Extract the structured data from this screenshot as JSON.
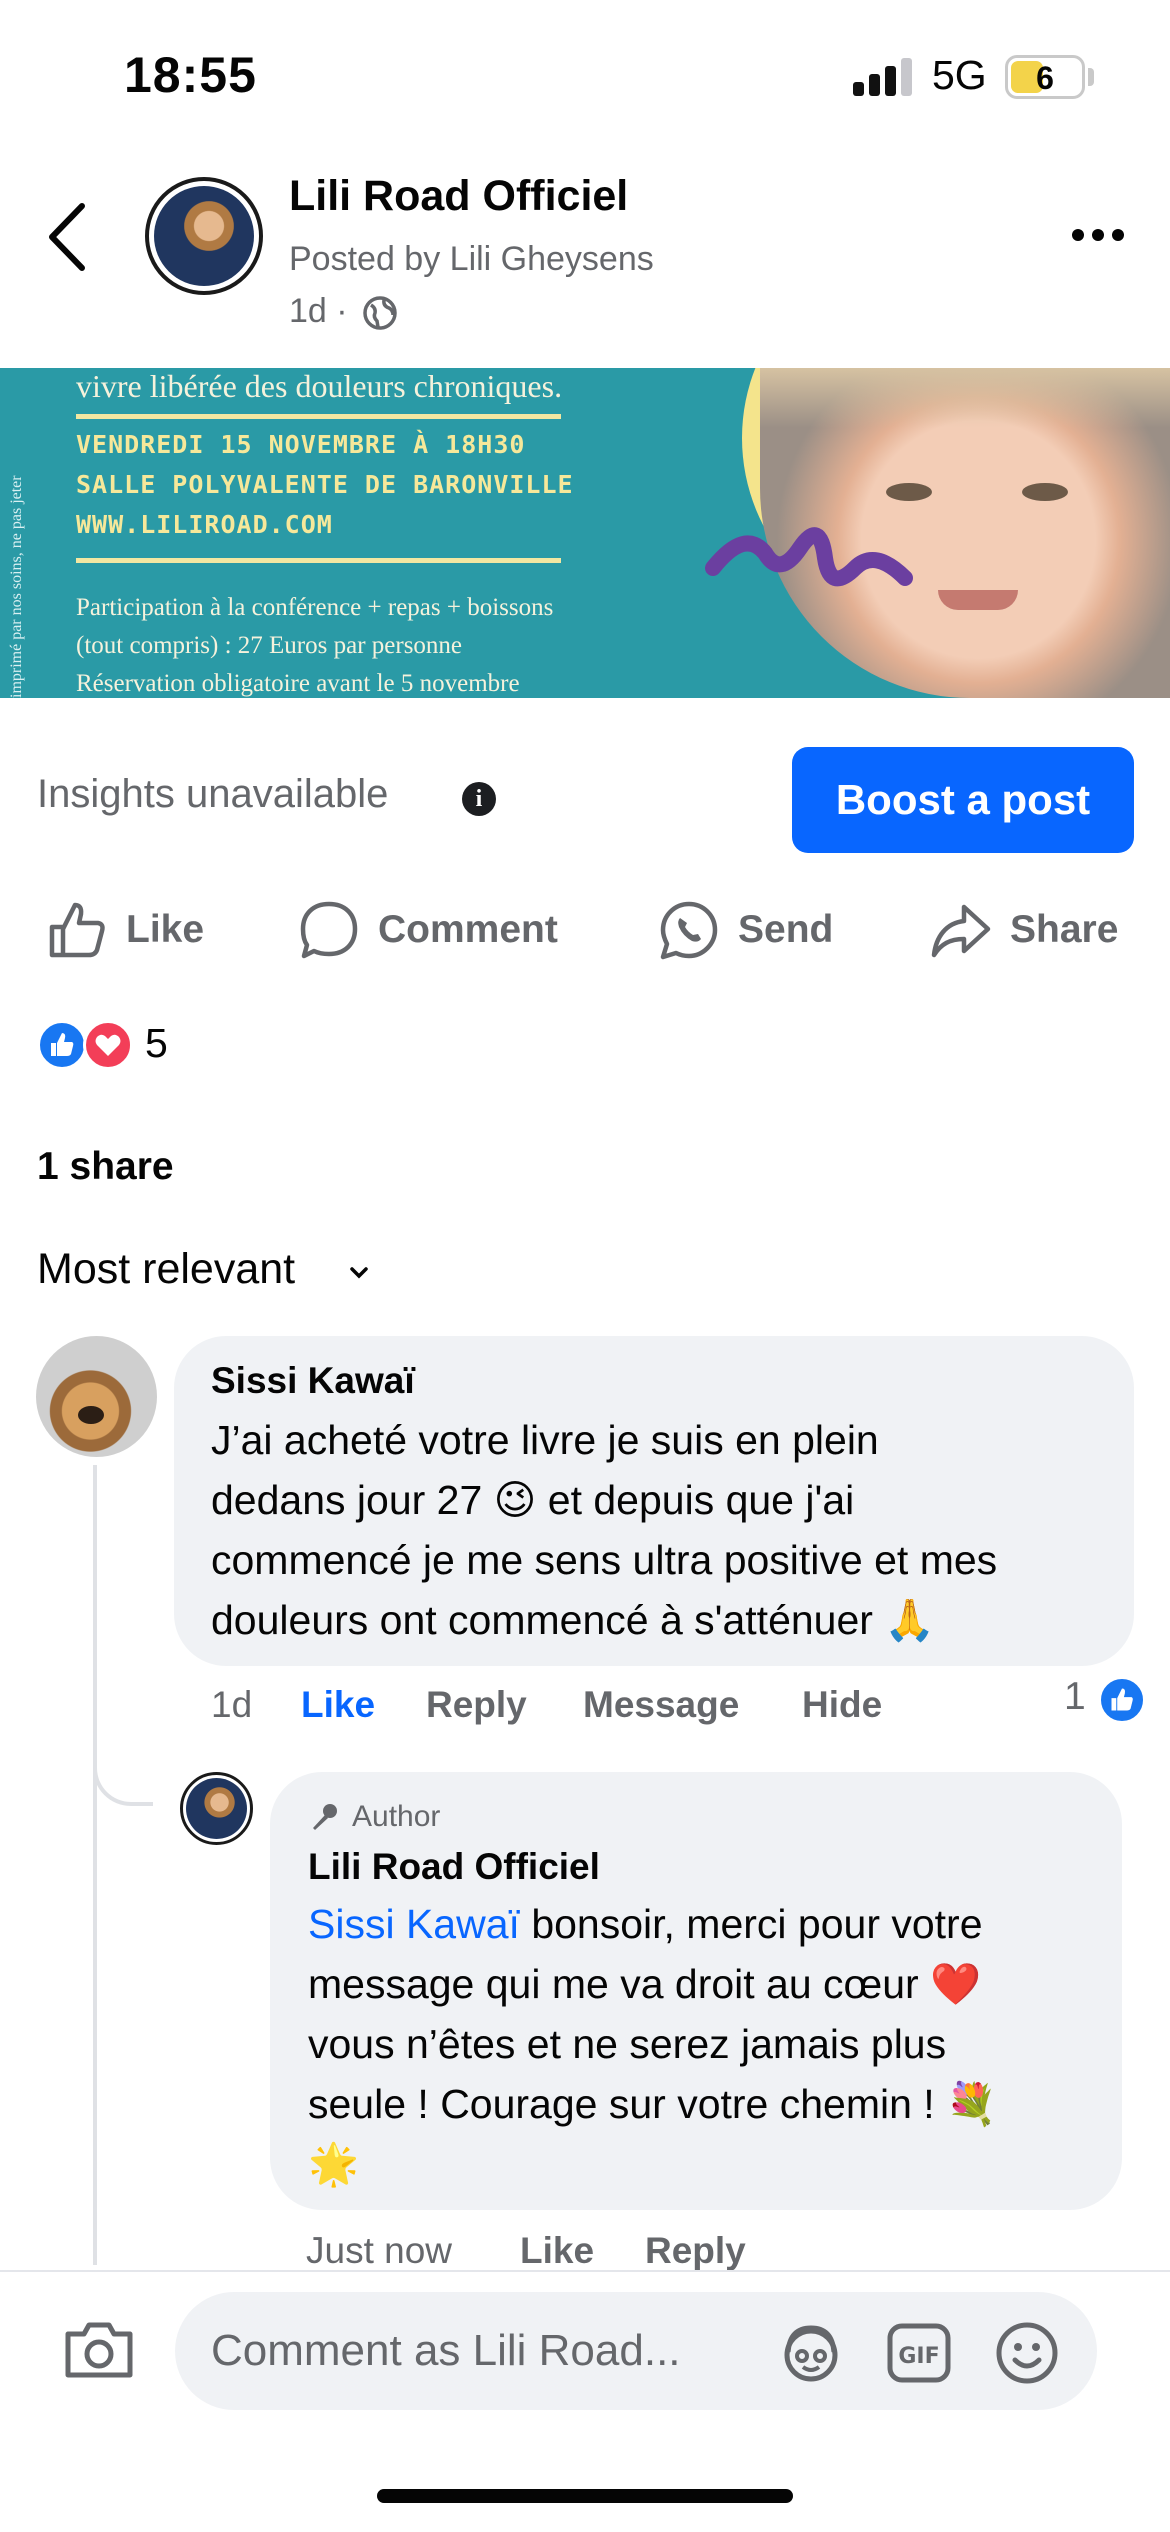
{
  "status_bar": {
    "time": "18:55",
    "network": "5G",
    "battery": "6"
  },
  "post_header": {
    "page_name": "Lili Road Officiel",
    "posted_by": "Posted by Lili Gheysens",
    "age": "1d ·"
  },
  "banner": {
    "side_text": "imprimé par nos soins, ne pas jeter",
    "line1": "vivre libérée des douleurs chroniques.",
    "event_date": "VENDREDI 15 NOVEMBRE À 18H30",
    "venue": "SALLE POLYVALENTE DE BARONVILLE",
    "website": "WWW.LILIROAD.COM",
    "price_line1": "Participation à la conférence + repas + boissons",
    "price_line2": "(tout compris) : 27 Euros par personne",
    "reservation": "Réservation obligatoire avant le 5 novembre"
  },
  "insights": {
    "label": "Insights unavailable",
    "boost_label": "Boost a post"
  },
  "actions": {
    "like": "Like",
    "comment": "Comment",
    "send": "Send",
    "share": "Share"
  },
  "reactions": {
    "count": "5",
    "types": [
      "like",
      "love"
    ]
  },
  "shares": "1 share",
  "sort_label": "Most relevant",
  "comments": [
    {
      "author": "Sissi Kawaï",
      "lines": [
        "J’ai acheté votre livre je suis en plein",
        "dedans jour 27 😉 et depuis que j'ai",
        "commencé je me sens ultra positive et mes",
        "douleurs ont commencé à s'atténuer 🙏"
      ],
      "age": "1d",
      "like": "Like",
      "reply": "Reply",
      "message": "Message",
      "hide": "Hide",
      "like_count": "1"
    }
  ],
  "reply": {
    "badge": "Author",
    "author": "Lili Road Officiel",
    "mention": "Sissi Kawaï",
    "line1_rest": " bonsoir, merci pour votre",
    "lines": [
      "message qui me va droit au cœur ❤️",
      "vous n’êtes et ne serez jamais plus",
      "seule ! Courage sur votre chemin ! 💐",
      "🌟"
    ],
    "age": "Just now",
    "like": "Like",
    "reply": "Reply"
  },
  "composer": {
    "placeholder": "Comment as Lili Road..."
  },
  "colors": {
    "accent": "#0866ff",
    "secondary_text": "#65676b",
    "bubble": "#f0f2f5",
    "like_blue": "#1877f2",
    "love_red": "#f33e58",
    "banner_teal": "#2a9aa6"
  }
}
